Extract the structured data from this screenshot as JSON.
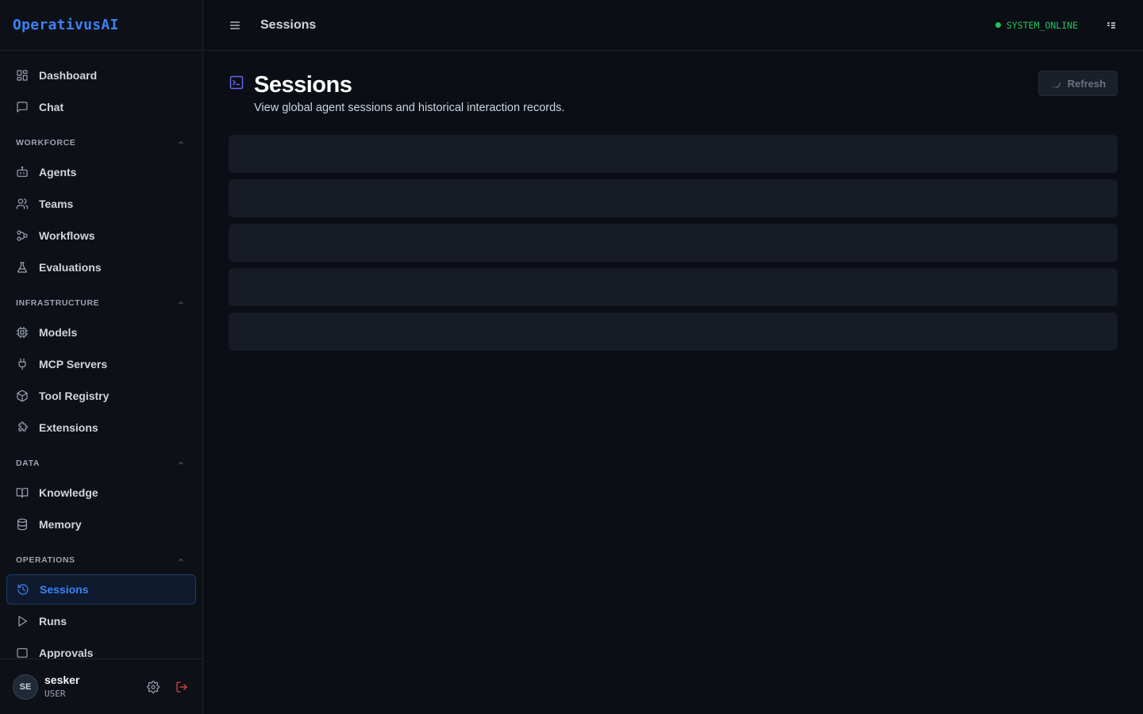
{
  "brand": {
    "name": "OperativusAI"
  },
  "nav": {
    "top": [
      {
        "label": "Dashboard",
        "icon": "dashboard-icon"
      },
      {
        "label": "Chat",
        "icon": "chat-icon"
      }
    ],
    "sections": [
      {
        "title": "WORKFORCE",
        "items": [
          {
            "label": "Agents",
            "icon": "bot-icon"
          },
          {
            "label": "Teams",
            "icon": "users-icon"
          },
          {
            "label": "Workflows",
            "icon": "workflow-icon"
          },
          {
            "label": "Evaluations",
            "icon": "flask-icon"
          }
        ]
      },
      {
        "title": "INFRASTRUCTURE",
        "items": [
          {
            "label": "Models",
            "icon": "cpu-icon"
          },
          {
            "label": "MCP Servers",
            "icon": "plug-icon"
          },
          {
            "label": "Tool Registry",
            "icon": "package-icon"
          },
          {
            "label": "Extensions",
            "icon": "puzzle-icon"
          }
        ]
      },
      {
        "title": "DATA",
        "items": [
          {
            "label": "Knowledge",
            "icon": "book-icon"
          },
          {
            "label": "Memory",
            "icon": "database-icon"
          }
        ]
      },
      {
        "title": "OPERATIONS",
        "items": [
          {
            "label": "Sessions",
            "icon": "history-icon",
            "active": true
          },
          {
            "label": "Runs",
            "icon": "play-icon"
          },
          {
            "label": "Approvals",
            "icon": "approvals-icon"
          }
        ]
      }
    ]
  },
  "user": {
    "initials": "SE",
    "name": "sesker",
    "role": "USER"
  },
  "topbar": {
    "title": "Sessions",
    "status": "SYSTEM_ONLINE"
  },
  "page": {
    "title": "Sessions",
    "subtitle": "View global agent sessions and historical interaction records.",
    "refresh_label": "Refresh",
    "skeleton_rows": 5
  },
  "colors": {
    "accent": "#3b82f6",
    "status_online": "#22c55e",
    "title_icon": "#6366f1",
    "logout": "#ef4444"
  }
}
